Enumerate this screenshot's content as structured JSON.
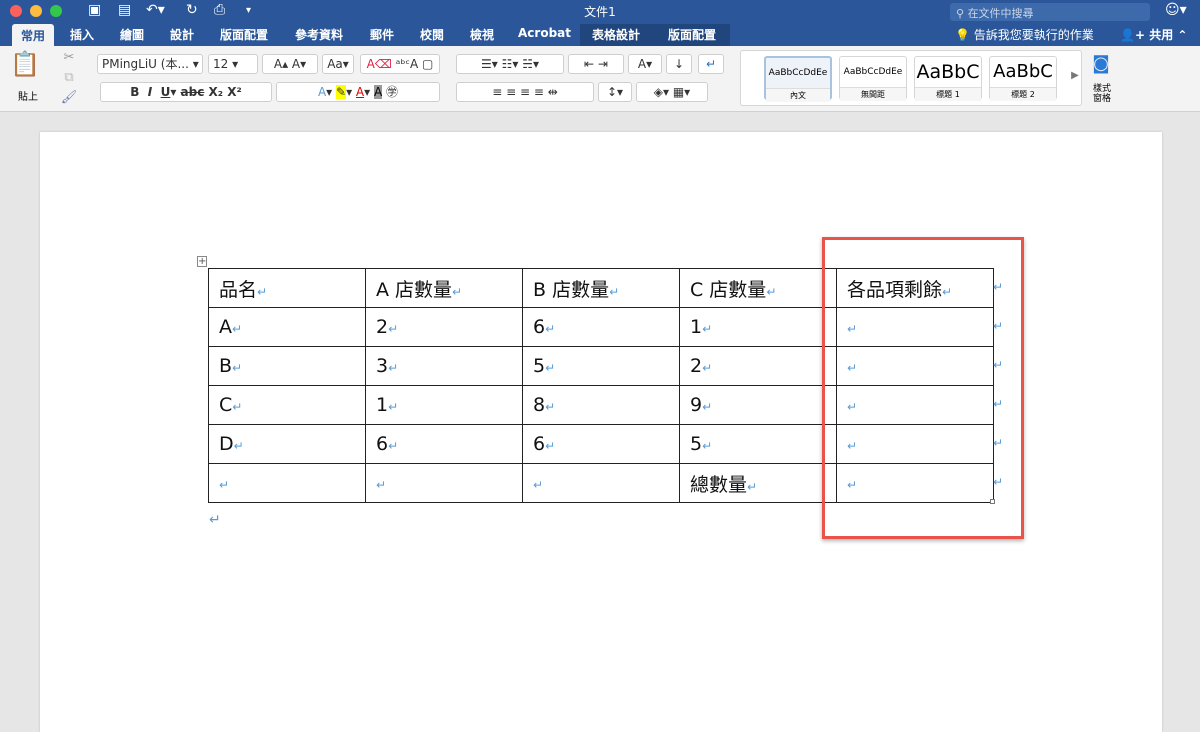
{
  "window": {
    "title": "文件1",
    "search_placeholder": "在文件中搜尋"
  },
  "tabs": [
    "常用",
    "插入",
    "繪圖",
    "設計",
    "版面配置",
    "參考資料",
    "郵件",
    "校閱",
    "檢視",
    "Acrobat",
    "表格設計",
    "版面配置"
  ],
  "tell_me": "告訴我您要執行的作業",
  "share": "共用",
  "ribbon": {
    "paste": "貼上",
    "font": "PMingLiU (本...",
    "size": "12",
    "styles": [
      {
        "preview": "AaBbCcDdEe",
        "name": "內文"
      },
      {
        "preview": "AaBbCcDdEe",
        "name": "無間距"
      },
      {
        "preview": "AaBbC",
        "name": "標題 1"
      },
      {
        "preview": "AaBbC",
        "name": "標題 2"
      }
    ],
    "styles_pane": "樣式窗格"
  },
  "colors": {
    "brand": "#2b579a",
    "highlight_box": "#e8544a",
    "para_mark": "#5a9bd5"
  },
  "table": {
    "rows": [
      [
        "品名",
        "A 店數量",
        "B 店數量",
        "C 店數量",
        "各品項剩餘"
      ],
      [
        "A",
        "2",
        "6",
        "1",
        ""
      ],
      [
        "B",
        "3",
        "5",
        "2",
        ""
      ],
      [
        "C",
        "1",
        "8",
        "9",
        ""
      ],
      [
        "D",
        "6",
        "6",
        "5",
        ""
      ],
      [
        "",
        "",
        "",
        "總數量",
        ""
      ]
    ]
  }
}
